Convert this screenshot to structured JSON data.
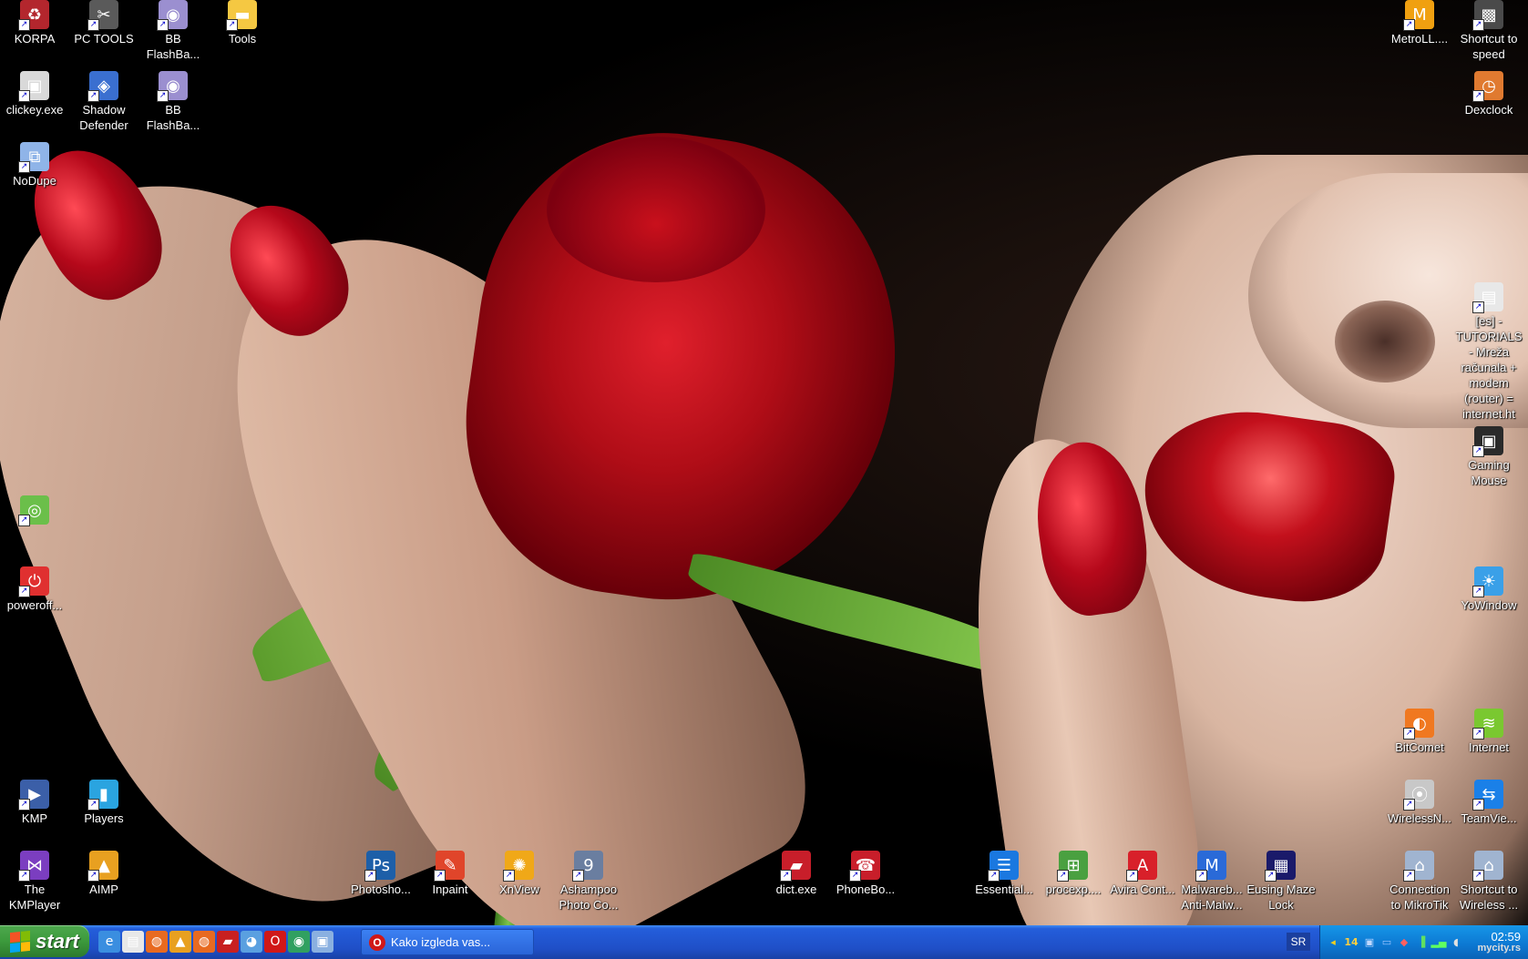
{
  "desktop": {
    "icons_left": [
      {
        "label": "KORPA",
        "icon": "recycle-bin-icon",
        "glyph": "♻",
        "color": "#b3262d"
      },
      {
        "label": "PC TOOLS",
        "icon": "tools-icon",
        "glyph": "✂",
        "color": "#5a5a5a"
      },
      {
        "label": "BB FlashBa...",
        "icon": "bb-flashback-icon",
        "glyph": "◉",
        "color": "#9b8fd0"
      },
      {
        "label": "Tools",
        "icon": "folder-icon",
        "glyph": "▬",
        "color": "#f5c842"
      },
      {
        "label": "clickey.exe",
        "icon": "clickey-icon",
        "glyph": "▣",
        "color": "#d9d9d9"
      },
      {
        "label": "Shadow Defender",
        "icon": "shadow-defender-icon",
        "glyph": "◈",
        "color": "#3a6fd0"
      },
      {
        "label": "BB FlashBa...",
        "icon": "bb-flashback-icon",
        "glyph": "◉",
        "color": "#9b8fd0"
      },
      {
        "label": "NoDupe",
        "icon": "nodupe-icon",
        "glyph": "⧉",
        "color": "#8fb4e8"
      },
      {
        "label": "",
        "icon": "cd-icon",
        "glyph": "◎",
        "color": "#6bbf4a"
      },
      {
        "label": "poweroff...",
        "icon": "poweroff-icon",
        "glyph": "⏻",
        "color": "#e03030"
      },
      {
        "label": "KMP",
        "icon": "kmp-icon",
        "glyph": "▶",
        "color": "#3b5fa8"
      },
      {
        "label": "Players",
        "icon": "players-icon",
        "glyph": "▮",
        "color": "#2aa4e0"
      },
      {
        "label": "The KMPlayer",
        "icon": "kmplayer-icon",
        "glyph": "⋈",
        "color": "#7b3ec0"
      },
      {
        "label": "AIMP",
        "icon": "aimp-icon",
        "glyph": "▲",
        "color": "#e8a020"
      }
    ],
    "icons_bottom": [
      {
        "label": "Photosho...",
        "icon": "photoshop-icon",
        "glyph": "Ps",
        "color": "#1d5fa8"
      },
      {
        "label": "Inpaint",
        "icon": "inpaint-icon",
        "glyph": "✎",
        "color": "#e0452a"
      },
      {
        "label": "XnView",
        "icon": "xnview-icon",
        "glyph": "✺",
        "color": "#f0a818"
      },
      {
        "label": "Ashampoo Photo Co...",
        "icon": "ashampoo-icon",
        "glyph": "9",
        "color": "#6a7ea0"
      },
      {
        "label": "dict.exe",
        "icon": "dict-icon",
        "glyph": "▰",
        "color": "#c81e2a"
      },
      {
        "label": "PhoneBo...",
        "icon": "phonebook-icon",
        "glyph": "☎",
        "color": "#c81e2a"
      },
      {
        "label": "Essential...",
        "icon": "essential-icon",
        "glyph": "☰",
        "color": "#1a78e0"
      },
      {
        "label": "procexp....",
        "icon": "procexp-icon",
        "glyph": "⊞",
        "color": "#4aa040"
      },
      {
        "label": "Avira Cont...",
        "icon": "avira-icon",
        "glyph": "A",
        "color": "#d8202a"
      },
      {
        "label": "Malwareb... Anti-Malw...",
        "icon": "malwarebytes-icon",
        "glyph": "M",
        "color": "#2a6ad8"
      },
      {
        "label": "Eusing Maze Lock",
        "icon": "maze-lock-icon",
        "glyph": "▦",
        "color": "#1a1a6a"
      }
    ],
    "icons_right": [
      {
        "label": "MetroLL....",
        "icon": "metroll-icon",
        "glyph": "M",
        "color": "#f0a010"
      },
      {
        "label": "Shortcut to speed",
        "icon": "speed-icon",
        "glyph": "▩",
        "color": "#4a4a4a"
      },
      {
        "label": "Dexclock",
        "icon": "dexclock-icon",
        "glyph": "◷",
        "color": "#e07a30"
      },
      {
        "label": "[es] - TUTORIALS - Mreža računala + modem (router) = internet.ht",
        "icon": "html-file-icon",
        "glyph": "▤",
        "color": "#e8e8e8"
      },
      {
        "label": "Gaming Mouse",
        "icon": "gaming-mouse-icon",
        "glyph": "▣",
        "color": "#2a2a2a"
      },
      {
        "label": "YoWindow",
        "icon": "yowindow-icon",
        "glyph": "☀",
        "color": "#3aa0e8"
      },
      {
        "label": "BitComet",
        "icon": "bitcomet-icon",
        "glyph": "◐",
        "color": "#f07820"
      },
      {
        "label": "Internet",
        "icon": "internet-icon",
        "glyph": "≋",
        "color": "#7ac830"
      },
      {
        "label": "WirelessN...",
        "icon": "wireless-icon",
        "glyph": "⦿",
        "color": "#c8c8c8"
      },
      {
        "label": "TeamVie...",
        "icon": "teamviewer-icon",
        "glyph": "⇆",
        "color": "#1a80e8"
      },
      {
        "label": "Connection to MikroTik",
        "icon": "connection-icon",
        "glyph": "⌂",
        "color": "#a0b4d0"
      },
      {
        "label": "Shortcut to Wireless ...",
        "icon": "wireless-shortcut-icon",
        "glyph": "⌂",
        "color": "#a0b4d0"
      }
    ]
  },
  "taskbar": {
    "start_label": "start",
    "quick_launch": [
      {
        "icon": "ie-icon",
        "glyph": "e",
        "color": "#3a8ee0"
      },
      {
        "icon": "notepad-icon",
        "glyph": "▤",
        "color": "#e8e8e8"
      },
      {
        "icon": "firefox-icon",
        "glyph": "◍",
        "color": "#e86a20"
      },
      {
        "icon": "aimp-small-icon",
        "glyph": "▲",
        "color": "#e8a020"
      },
      {
        "icon": "firefox2-icon",
        "glyph": "◍",
        "color": "#e86a20"
      },
      {
        "icon": "car-icon",
        "glyph": "▰",
        "color": "#c82020"
      },
      {
        "icon": "globe-icon",
        "glyph": "◕",
        "color": "#5aa0e0"
      },
      {
        "icon": "opera-icon",
        "glyph": "O",
        "color": "#d01818"
      },
      {
        "icon": "earth-icon",
        "glyph": "◉",
        "color": "#30a060"
      },
      {
        "icon": "app-icon",
        "glyph": "▣",
        "color": "#8ab0e0"
      }
    ],
    "active_task": {
      "label": "Kako izgleda vas...",
      "icon": "opera-icon"
    },
    "language": "SR",
    "tray_count": "14",
    "clock": "02:59",
    "watermark": "mycity.rs"
  }
}
